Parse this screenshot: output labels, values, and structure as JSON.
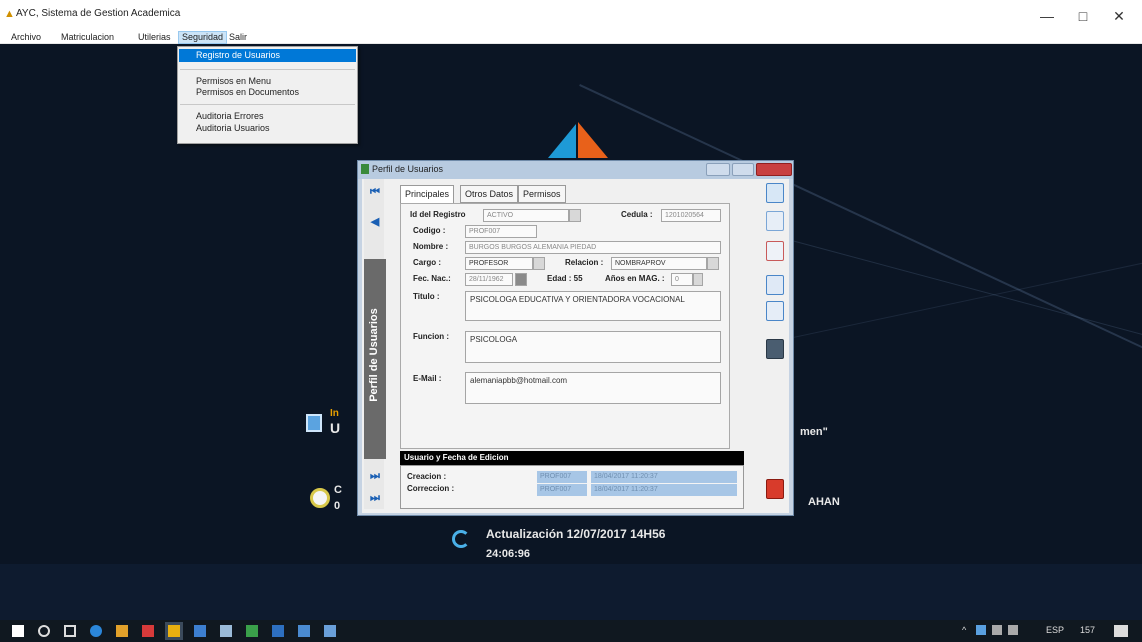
{
  "window": {
    "title": "AYC, Sistema de Gestion Academica",
    "minimize": "—",
    "maximize": "□",
    "close": "✕"
  },
  "menubar": {
    "items": [
      "Archivo",
      "Matriculacion",
      "Utilerias",
      "Seguridad",
      "Salir"
    ]
  },
  "dropdown": {
    "items": [
      "Registro de Usuarios",
      "Permisos en Menu",
      "Permisos en Documentos",
      "Auditoria Errores",
      "Auditoria Usuarios"
    ]
  },
  "desktop": {
    "line1_prefix": "In",
    "line1_prefix2": "U",
    "line1_suffix": "men\"",
    "line2_prefix": "C",
    "line2_prefix2": "0",
    "line2_suffix": "AHAN",
    "update_text": "Actualización 12/07/2017 14H56",
    "clock": "24:06:96"
  },
  "dialog": {
    "title": "Perfil de Usuarios",
    "side_label": "Perfil de Usuarios",
    "tabs": [
      "Principales",
      "Otros Datos",
      "Permisos"
    ],
    "labels": {
      "id_registro": "Id del Registro",
      "cedula": "Cedula :",
      "codigo": "Codigo :",
      "nombre": "Nombre :",
      "cargo": "Cargo :",
      "relacion": "Relacion :",
      "fec_nac": "Fec. Nac.:",
      "edad": "Edad : 55",
      "anos_mag": "Años en MAG. :",
      "titulo": "Titulo :",
      "funcion": "Funcion :",
      "email": "E-Mail :"
    },
    "values": {
      "estado": "ACTIVO",
      "cedula": "1201020564",
      "codigo": "PROF007",
      "nombre": "BURGOS BURGOS ALEMANIA PIEDAD",
      "cargo": "PROFESOR",
      "relacion": "NOMBRAPROV",
      "fec_nac": "28/11/1962",
      "anos_mag": "0",
      "titulo": "PSICOLOGA EDUCATIVA Y ORIENTADORA VOCACIONAL",
      "funcion": "PSICOLOGA",
      "email": "alemaniapbb@hotmail.com"
    },
    "audit": {
      "header": "Usuario y Fecha de Edicion",
      "creacion_label": "Creacion :",
      "correccion_label": "Correccion :",
      "creacion_user": "PROF007",
      "creacion_date": "18/04/2017 11:20:37",
      "correccion_user": "PROF007",
      "correccion_date": "18/04/2017 11:20:37"
    }
  },
  "taskbar": {
    "tray": [
      "^",
      "ESP",
      "157"
    ]
  },
  "colors": {
    "desktop_bg": "#0b1524",
    "menu_highlight": "#0078d7",
    "audit_field": "#a7c6e6",
    "logo_blue": "#1e9ad6",
    "logo_orange": "#e8611a"
  }
}
